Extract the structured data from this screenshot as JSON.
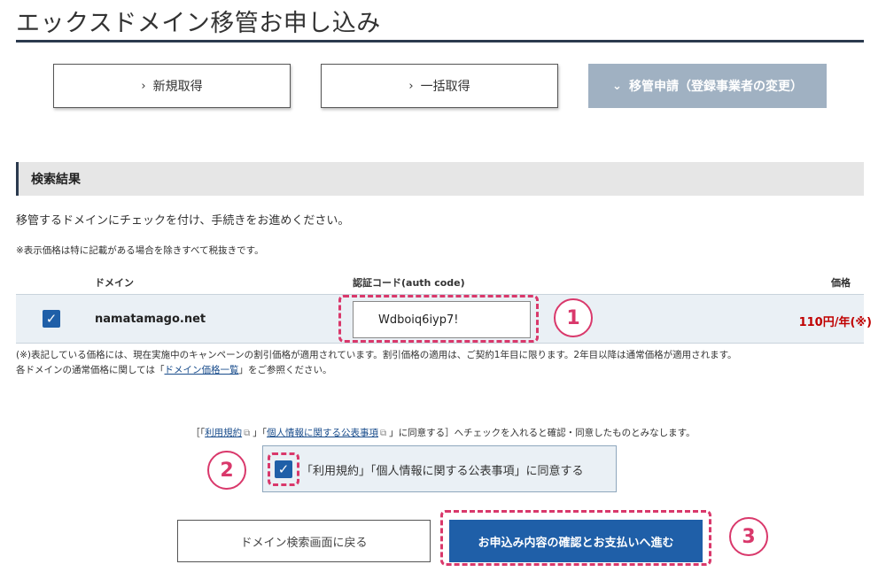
{
  "page": {
    "title": "エックスドメイン移管お申し込み"
  },
  "modes": [
    {
      "label": "新規取得",
      "chevron": "›",
      "active": false
    },
    {
      "label": "一括取得",
      "chevron": "›",
      "active": false
    },
    {
      "label": "移管申請（登録事業者の変更）",
      "chevron": "⌄",
      "active": true
    }
  ],
  "results": {
    "section_title": "検索結果",
    "instruction": "移管するドメインにチェックを付け、手続きをお進めください。",
    "tax_note": "※表示価格は特に記載がある場合を除きすべて税抜きです。",
    "columns": {
      "domain": "ドメイン",
      "auth": "認証コード(auth code)",
      "price": "価格"
    },
    "row": {
      "checked": true,
      "domain": "namatamago.net",
      "auth_code": "Wdboiq6iyp7!",
      "price": "110円/年(※)"
    }
  },
  "campaign_note": {
    "line1": "(※)表記している価格には、現在実施中のキャンペーンの割引価格が適用されています。割引価格の適用は、ご契約1年目に限ります。2年目以降は通常価格が適用されます。",
    "line2_pre": "各ドメインの通常価格に関しては「",
    "line2_link": "ドメイン価格一覧",
    "line2_post": "」をご参照ください。"
  },
  "terms": {
    "open": "［「",
    "link1": "利用規約",
    "mid": "」「",
    "link2": "個人情報に関する公表事項",
    "close": "」に同意する］へチェックを入れると確認・同意したものとみなします。",
    "agree_label": "「利用規約」「個人情報に関する公表事項」に同意する",
    "agree_checked": true
  },
  "buttons": {
    "back": "ドメイン検索画面に戻る",
    "proceed": "お申込み内容の確認とお支払いへ進む"
  },
  "annotations": [
    "1",
    "2",
    "3"
  ],
  "colors": {
    "primary": "#1f5fa8",
    "price": "#c00000",
    "annotation": "#d9386b",
    "active_mode": "#a0b1c2"
  },
  "icons": {
    "check": "✓",
    "external_link": "⧉"
  }
}
